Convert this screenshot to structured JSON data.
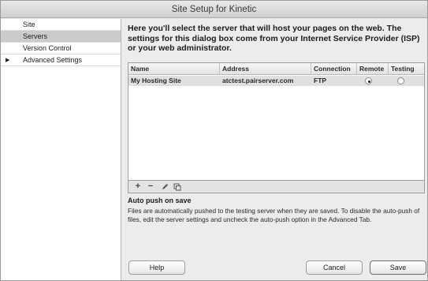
{
  "window": {
    "title": "Site Setup for Kinetic"
  },
  "sidebar": {
    "items": [
      {
        "label": "Site"
      },
      {
        "label": "Servers"
      },
      {
        "label": "Version Control"
      },
      {
        "label": "Advanced Settings"
      }
    ]
  },
  "intro": {
    "text": "Here you'll select the server that will host your pages on the web. The settings for this dialog box come from your Internet Service Provider (ISP) or your web administrator."
  },
  "table": {
    "headers": [
      "Name",
      "Address",
      "Connection",
      "Remote",
      "Testing"
    ],
    "rows": [
      {
        "name": "My Hosting Site",
        "address": "atctest.pairserver.com",
        "connection": "FTP",
        "remote": true,
        "testing": false
      }
    ]
  },
  "toolbar": {
    "icons": [
      "plus-icon",
      "minus-icon",
      "pencil-icon",
      "duplicate-icon"
    ]
  },
  "auto_push": {
    "title": "Auto push on save",
    "description": "Files are automatically pushed to the testing server when they are saved. To disable the auto-push of files, edit the server settings and uncheck the auto-push option in the Advanced Tab."
  },
  "buttons": {
    "help": "Help",
    "cancel": "Cancel",
    "save": "Save"
  }
}
